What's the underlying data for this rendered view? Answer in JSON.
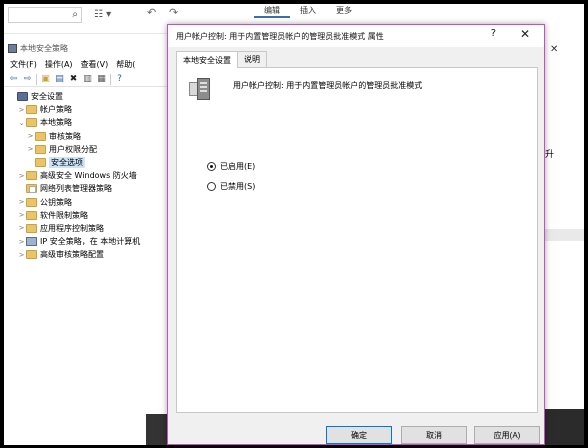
{
  "bg_editor": {
    "tabs": [
      "编辑",
      "插入",
      "更多"
    ],
    "search_icon": "search-icon"
  },
  "lsp_window": {
    "title": "本地安全策略",
    "menu": [
      "文件(F)",
      "操作(A)",
      "查看(V)",
      "帮助("
    ],
    "tree": [
      {
        "label": "安全设置",
        "depth": 0,
        "toggle": "",
        "icon": "shield"
      },
      {
        "label": "帐户策略",
        "depth": 1,
        "toggle": ">",
        "icon": "folder"
      },
      {
        "label": "本地策略",
        "depth": 1,
        "toggle": "v",
        "icon": "folder"
      },
      {
        "label": "审核策略",
        "depth": 2,
        "toggle": ">",
        "icon": "folder"
      },
      {
        "label": "用户权限分配",
        "depth": 2,
        "toggle": ">",
        "icon": "folder"
      },
      {
        "label": "安全选项",
        "depth": 2,
        "toggle": "",
        "icon": "folder",
        "selected": true
      },
      {
        "label": "高级安全 Windows 防火墙",
        "depth": 1,
        "toggle": ">",
        "icon": "folder"
      },
      {
        "label": "网络列表管理器策略",
        "depth": 1,
        "toggle": "",
        "icon": "doc"
      },
      {
        "label": "公钥策略",
        "depth": 1,
        "toggle": ">",
        "icon": "folder"
      },
      {
        "label": "软件限制策略",
        "depth": 1,
        "toggle": ">",
        "icon": "folder"
      },
      {
        "label": "应用程序控制策略",
        "depth": 1,
        "toggle": ">",
        "icon": "folder"
      },
      {
        "label": "IP 安全策略，在 本地计算机",
        "depth": 1,
        "toggle": ">",
        "icon": "computer"
      },
      {
        "label": "高级审核策略配置",
        "depth": 1,
        "toggle": ">",
        "icon": "folder"
      }
    ]
  },
  "bg_right": {
    "text": "升"
  },
  "dialog": {
    "title": "用户帐户控制: 用于内置管理员帐户的管理员批准模式 属性",
    "help": "?",
    "close": "✕",
    "tabs": [
      "本地安全设置",
      "说明"
    ],
    "policy_name": "用户帐户控制: 用于内置管理员帐户的管理员批准模式",
    "options": [
      {
        "label": "已启用(E)",
        "checked": true
      },
      {
        "label": "已禁用(S)",
        "checked": false
      }
    ],
    "buttons": {
      "ok": "确定",
      "cancel": "取消",
      "apply": "应用(A)"
    }
  }
}
